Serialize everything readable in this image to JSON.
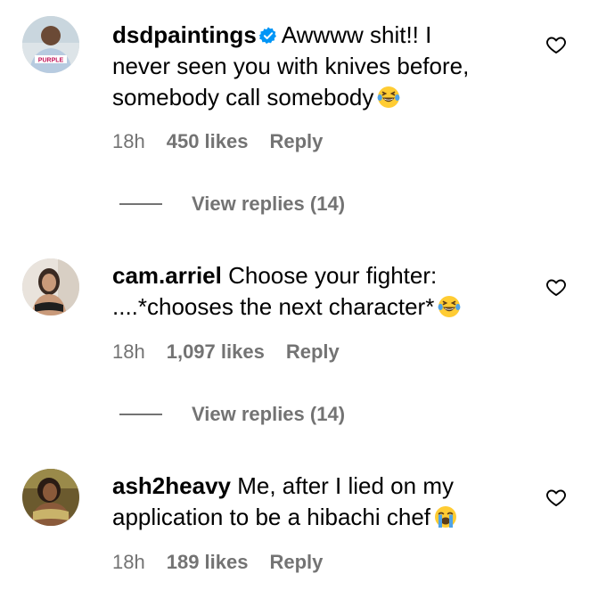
{
  "comments": [
    {
      "username": "dsdpaintings",
      "verified": true,
      "text_lines": [
        "Awwww shit!! I",
        "never seen you with knives before,",
        "somebody call somebody"
      ],
      "emoji": "laughing-tears",
      "time": "18h",
      "likes": "450 likes",
      "reply_label": "Reply",
      "view_replies_label": "View replies (14)",
      "avatar_badge": "PURPLE"
    },
    {
      "username": "cam.arriel",
      "verified": false,
      "text_lines": [
        "Choose your fighter:",
        "....*chooses the next character*"
      ],
      "emoji": "laughing-tears",
      "time": "18h",
      "likes": "1,097 likes",
      "reply_label": "Reply",
      "view_replies_label": "View replies (14)"
    },
    {
      "username": "ash2heavy",
      "verified": false,
      "text_lines": [
        "Me, after I lied on my",
        "application to be a hibachi chef"
      ],
      "emoji": "loudly-crying",
      "time": "18h",
      "likes": "189 likes",
      "reply_label": "Reply"
    }
  ],
  "colors": {
    "text": "#000000",
    "meta": "#737373",
    "verified_blue": "#0095f6",
    "emoji_yellow": "#ffcc33"
  }
}
